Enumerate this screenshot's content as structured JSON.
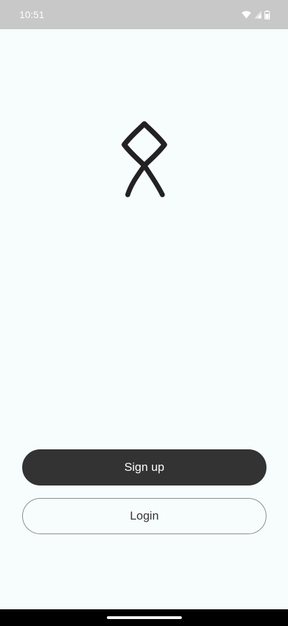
{
  "status_bar": {
    "time": "10:51",
    "icons": [
      "wifi-icon",
      "cellular-signal-icon",
      "battery-icon"
    ]
  },
  "logo": {
    "icon": "othala-rune-logo"
  },
  "actions": {
    "signup_label": "Sign up",
    "login_label": "Login"
  },
  "colors": {
    "background": "#f7fdfc",
    "status_bar": "#c8c8c8",
    "primary_button": "#333333",
    "primary_button_text": "#ffffff",
    "secondary_button_border": "#8a8a8a",
    "nav_bar": "#000000"
  }
}
